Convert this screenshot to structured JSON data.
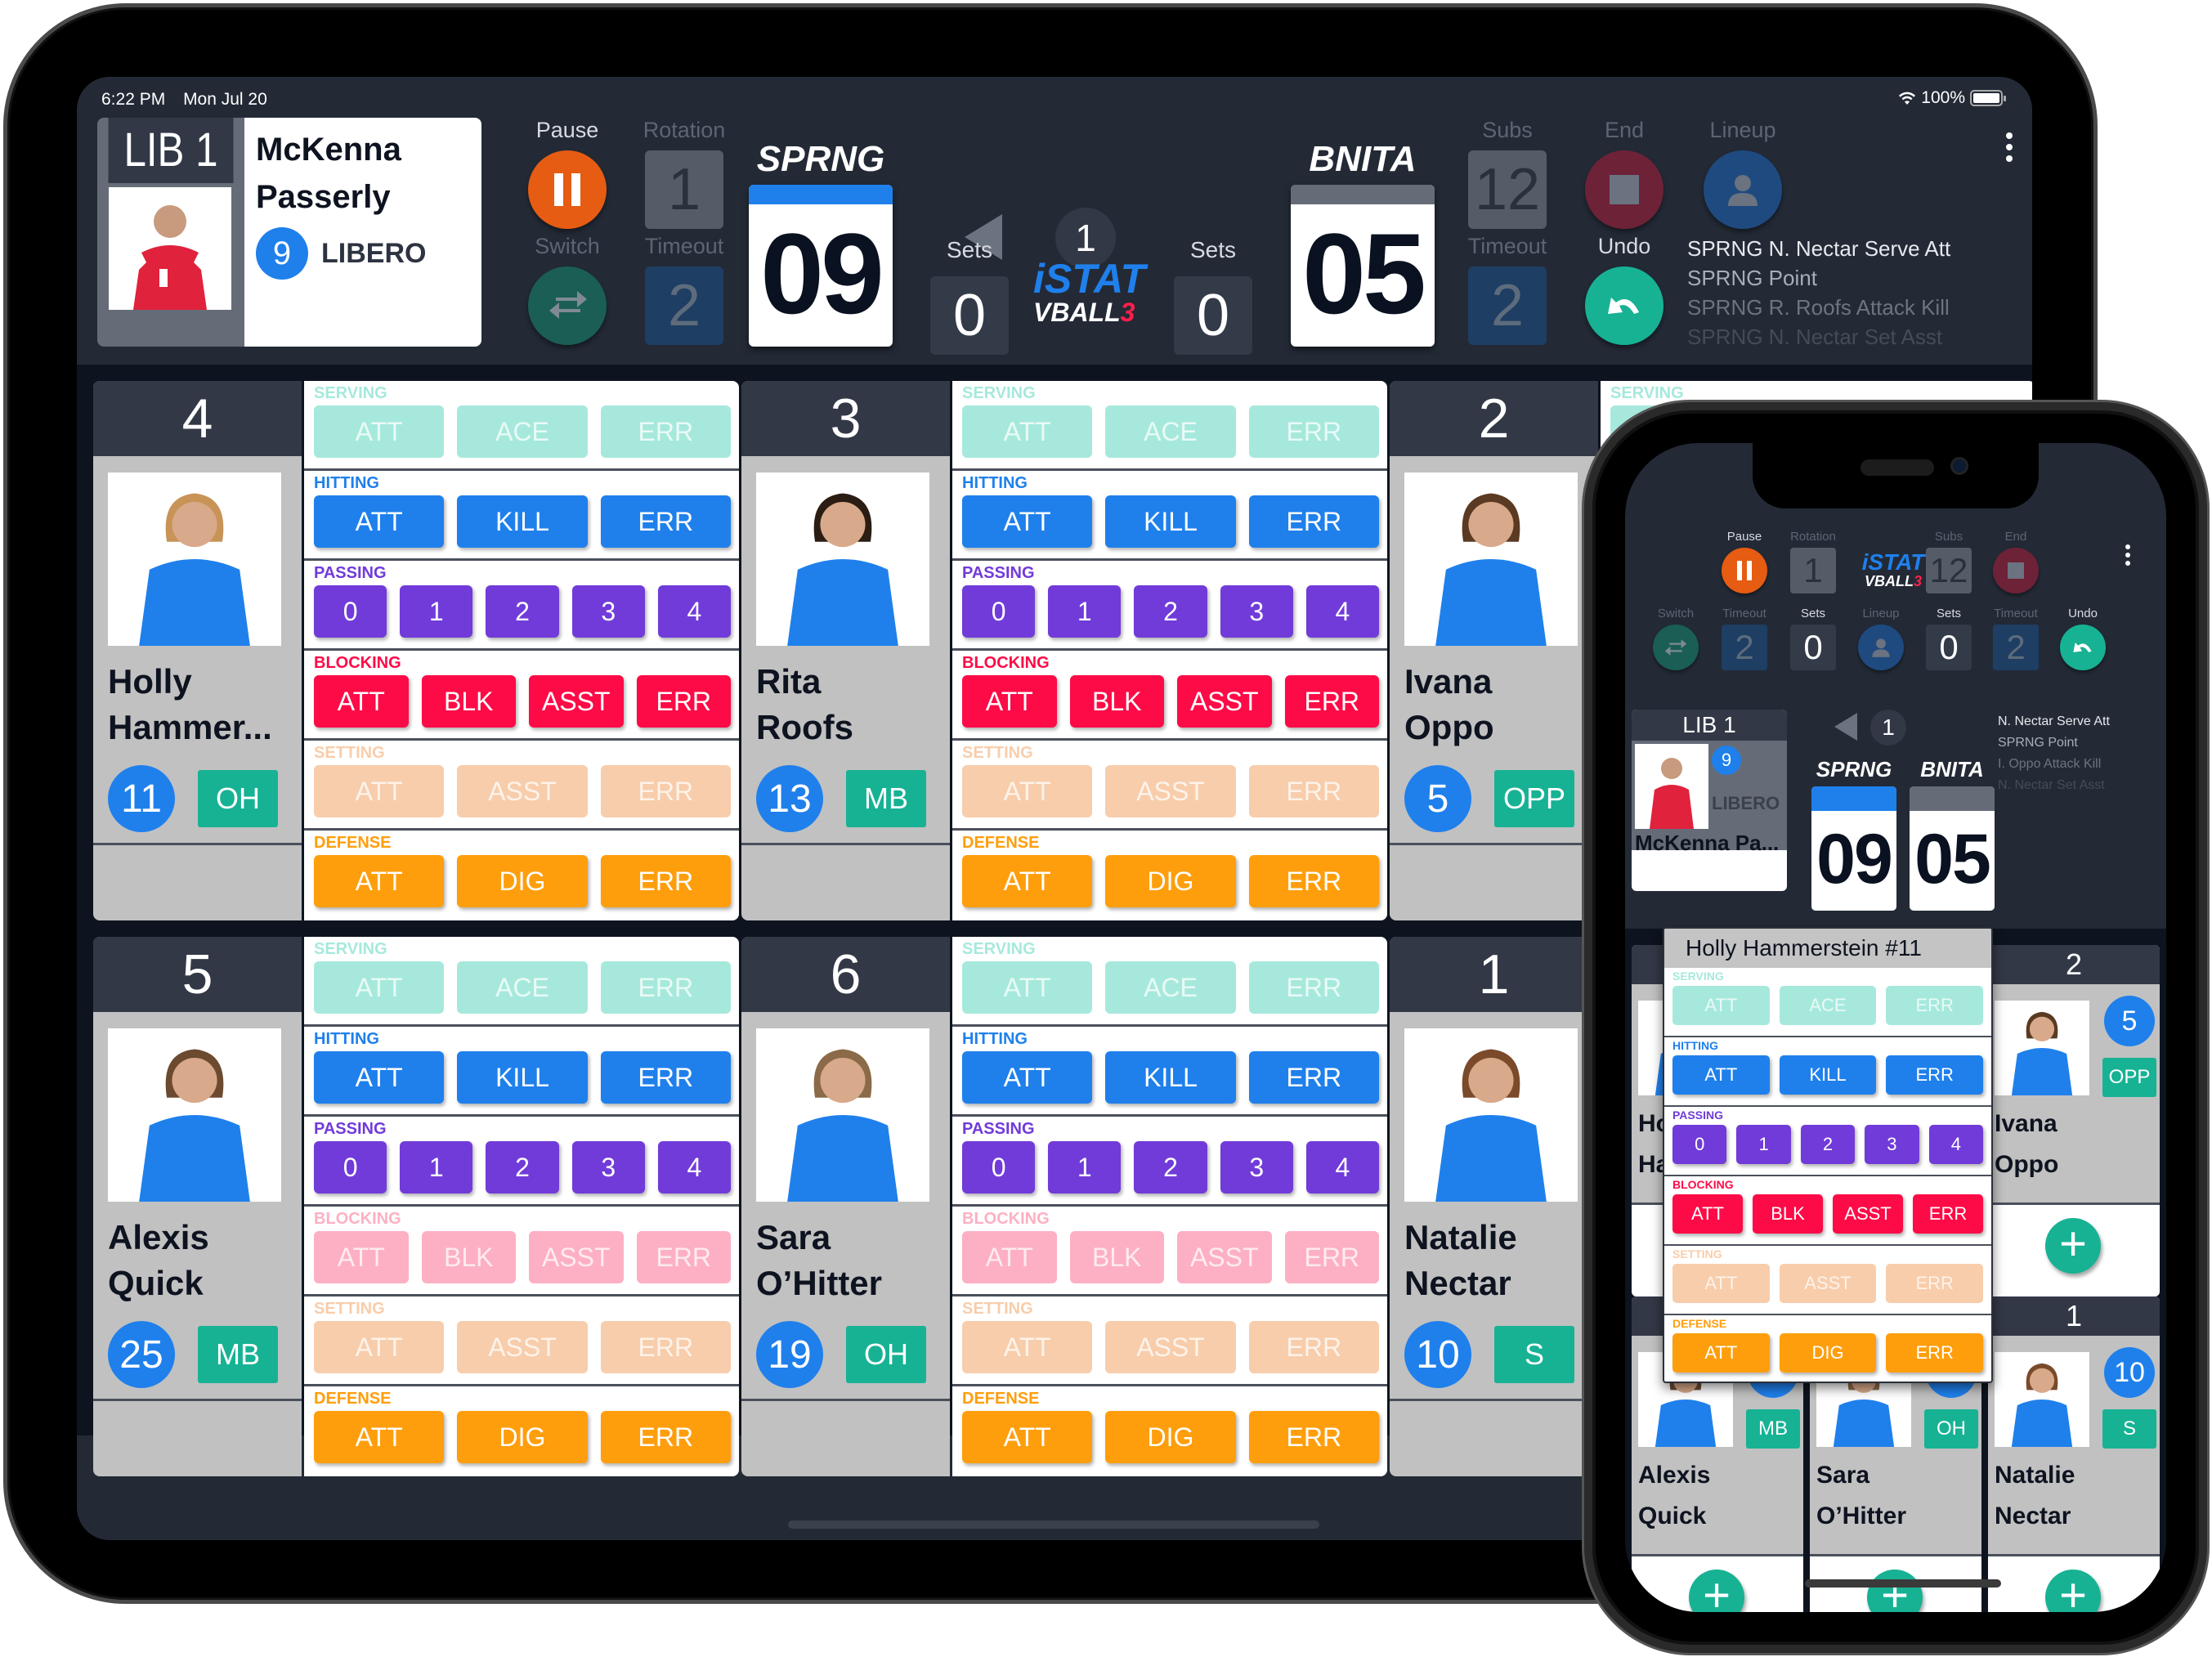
{
  "colors": {
    "bg_dark": "#232a36",
    "court": "#0d141f",
    "blue": "#1f80ec",
    "teal": "#17b294",
    "orange_pause": "#e65c12",
    "end_red": "#6d2237",
    "switch_green": "#1a5e55",
    "lineup_blue": "#1e4a7f",
    "timeout_blue": "#1e3e63",
    "rotation_gray": "#555c68",
    "serving": "#a6e9dc",
    "hitting": "#1f80ec",
    "passing": "#713bd9",
    "blocking": "#fd0b47",
    "blocking_dim": "#fdb0c3",
    "setting_dim": "#f8cdab",
    "defense": "#ff9e0c",
    "serving_label": "#a6e9dc",
    "setting_label": "#f8cdab"
  },
  "status_bar": {
    "time": "6:22 PM",
    "date": "Mon Jul 20",
    "battery": "100%",
    "wifi_icon": "wifi-icon"
  },
  "libero": {
    "title": "LIB 1",
    "first_name": "McKenna",
    "last_name": "Passerly",
    "short_name": "McKenna Pa...",
    "number": "9",
    "position": "LIBERO"
  },
  "controls": {
    "pause": "Pause",
    "rotation": "Rotation",
    "rotation_value": "1",
    "switch": "Switch",
    "timeout": "Timeout",
    "home_timeouts": "2",
    "subs": "Subs",
    "subs_value": "12",
    "away_timeouts": "2",
    "end": "End",
    "undo": "Undo",
    "lineup": "Lineup",
    "more_icon": "more-vertical-icon"
  },
  "scoreboard": {
    "home_team": "SPRNG",
    "away_team": "BNITA",
    "home_score": "09",
    "away_score": "05",
    "sets_label": "Sets",
    "home_sets": "0",
    "away_sets": "0",
    "current_set": "1",
    "serving_side": "home",
    "logo_top": "iSTAT",
    "logo_bottom": "VBALL",
    "logo_num": "3"
  },
  "play_log": {
    "tablet": [
      "SPRNG N. Nectar Serve Att",
      "SPRNG Point",
      "SPRNG R. Roofs Attack Kill",
      "SPRNG N. Nectar Set Asst"
    ],
    "phone": [
      "N. Nectar Serve Att",
      "SPRNG Point",
      "I. Oppo Attack Kill",
      "N. Nectar Set Asst"
    ]
  },
  "stat_sections": {
    "serving": {
      "label": "SERVING",
      "buttons": [
        "ATT",
        "ACE",
        "ERR"
      ]
    },
    "hitting": {
      "label": "HITTING",
      "buttons": [
        "ATT",
        "KILL",
        "ERR"
      ]
    },
    "passing": {
      "label": "PASSING",
      "buttons": [
        "0",
        "1",
        "2",
        "3",
        "4"
      ]
    },
    "blocking": {
      "label": "BLOCKING",
      "buttons": [
        "ATT",
        "BLK",
        "ASST",
        "ERR"
      ]
    },
    "setting": {
      "label": "SETTING",
      "buttons": [
        "ATT",
        "ASST",
        "ERR"
      ]
    },
    "defense": {
      "label": "DEFENSE",
      "buttons": [
        "ATT",
        "DIG",
        "ERR"
      ]
    }
  },
  "players": [
    {
      "rotation": "4",
      "first": "Holly",
      "last": "Hammer...",
      "full": "Holly Hammerstein",
      "number": "11",
      "position": "OH",
      "blocking_active": true
    },
    {
      "rotation": "3",
      "first": "Rita",
      "last": "Roofs",
      "number": "13",
      "position": "MB",
      "blocking_active": true
    },
    {
      "rotation": "2",
      "first": "Ivana",
      "last": "Oppo",
      "number": "5",
      "position": "OPP",
      "blocking_active": true
    },
    {
      "rotation": "5",
      "first": "Alexis",
      "last": "Quick",
      "number": "25",
      "position": "MB",
      "blocking_active": false
    },
    {
      "rotation": "6",
      "first": "Sara",
      "last": "O’Hitter",
      "number": "19",
      "position": "OH",
      "blocking_active": false
    },
    {
      "rotation": "1",
      "first": "Natalie",
      "last": "Nectar",
      "number": "10",
      "position": "S",
      "blocking_active": false
    }
  ],
  "phone_popup": {
    "title": "Holly Hammerstein  #11"
  },
  "phone_cards_visible_numbers": {
    "card4": "11",
    "card3": "13"
  },
  "add_button_label": "+"
}
